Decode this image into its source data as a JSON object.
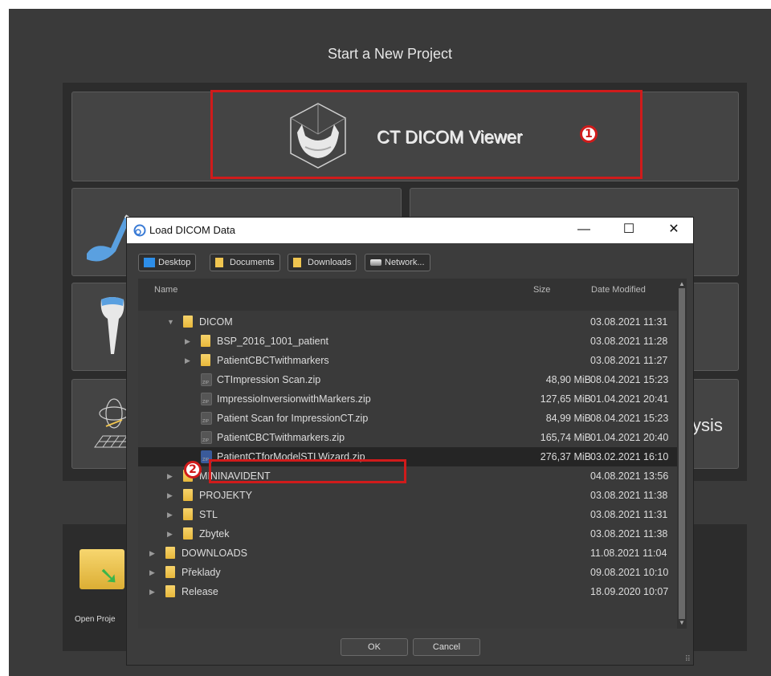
{
  "app": {
    "title": "Start a New Project",
    "ct_tile_label": "CT DICOM Viewer",
    "open_project_label": "Open Proje",
    "right_tile_text": "ysis"
  },
  "badges": {
    "one": "1",
    "two": "2"
  },
  "dialog": {
    "title": "Load DICOM Data",
    "controls": {
      "minimize": "—",
      "maximize": "☐",
      "close": "✕"
    },
    "toolbar": [
      {
        "label": "Desktop",
        "icon": "desktop-icon"
      },
      {
        "label": "Documents",
        "icon": "folder-icon"
      },
      {
        "label": "Downloads",
        "icon": "folder-icon"
      },
      {
        "label": "Network...",
        "icon": "network-icon"
      }
    ],
    "columns": {
      "name": "Name",
      "size": "Size",
      "date": "Date Modified"
    },
    "rows": [
      {
        "name": "DICOM",
        "type": "folder",
        "depth": 2,
        "expanded": true,
        "size": "",
        "date": "03.08.2021 11:31"
      },
      {
        "name": "BSP_2016_1001_patient",
        "type": "folder",
        "depth": 3,
        "expanded": false,
        "size": "",
        "date": "03.08.2021 11:28"
      },
      {
        "name": "PatientCBCTwithmarkers",
        "type": "folder",
        "depth": 3,
        "expanded": false,
        "size": "",
        "date": "03.08.2021 11:27"
      },
      {
        "name": "CTImpression Scan.zip",
        "type": "file",
        "depth": 3,
        "size": "48,90 MiB",
        "date": "08.04.2021 15:23"
      },
      {
        "name": "ImpressioInversionwithMarkers.zip",
        "type": "file",
        "depth": 3,
        "size": "127,65 MiB",
        "date": "01.04.2021 20:41"
      },
      {
        "name": "Patient Scan for ImpressionCT.zip",
        "type": "file",
        "depth": 3,
        "size": "84,99 MiB",
        "date": "08.04.2021 15:23"
      },
      {
        "name": "PatientCBCTwithmarkers.zip",
        "type": "file",
        "depth": 3,
        "size": "165,74 MiB",
        "date": "01.04.2021 20:40"
      },
      {
        "name": "PatientCTforModelSTLWizard.zip",
        "type": "file",
        "depth": 3,
        "size": "276,37 MiB",
        "date": "03.02.2021 16:10",
        "selected": true
      },
      {
        "name": "MININAVIDENT",
        "type": "folder",
        "depth": 2,
        "expanded": false,
        "size": "",
        "date": "04.08.2021 13:56"
      },
      {
        "name": "PROJEKTY",
        "type": "folder",
        "depth": 2,
        "expanded": false,
        "size": "",
        "date": "03.08.2021 11:38"
      },
      {
        "name": "STL",
        "type": "folder",
        "depth": 2,
        "expanded": false,
        "size": "",
        "date": "03.08.2021 11:31"
      },
      {
        "name": "Zbytek",
        "type": "folder",
        "depth": 2,
        "expanded": false,
        "size": "",
        "date": "03.08.2021 11:38"
      },
      {
        "name": "DOWNLOADS",
        "type": "folder",
        "depth": 1,
        "expanded": false,
        "size": "",
        "date": "11.08.2021 11:04"
      },
      {
        "name": "Překlady",
        "type": "folder",
        "depth": 1,
        "expanded": false,
        "size": "",
        "date": "09.08.2021 10:10"
      },
      {
        "name": "Release",
        "type": "folder",
        "depth": 1,
        "expanded": false,
        "size": "",
        "date": "18.09.2020 10:07"
      }
    ],
    "ok_label": "OK",
    "cancel_label": "Cancel"
  },
  "colors": {
    "highlight": "#d01b1b",
    "folder": "#f0c550",
    "background": "#3a3a3a"
  }
}
